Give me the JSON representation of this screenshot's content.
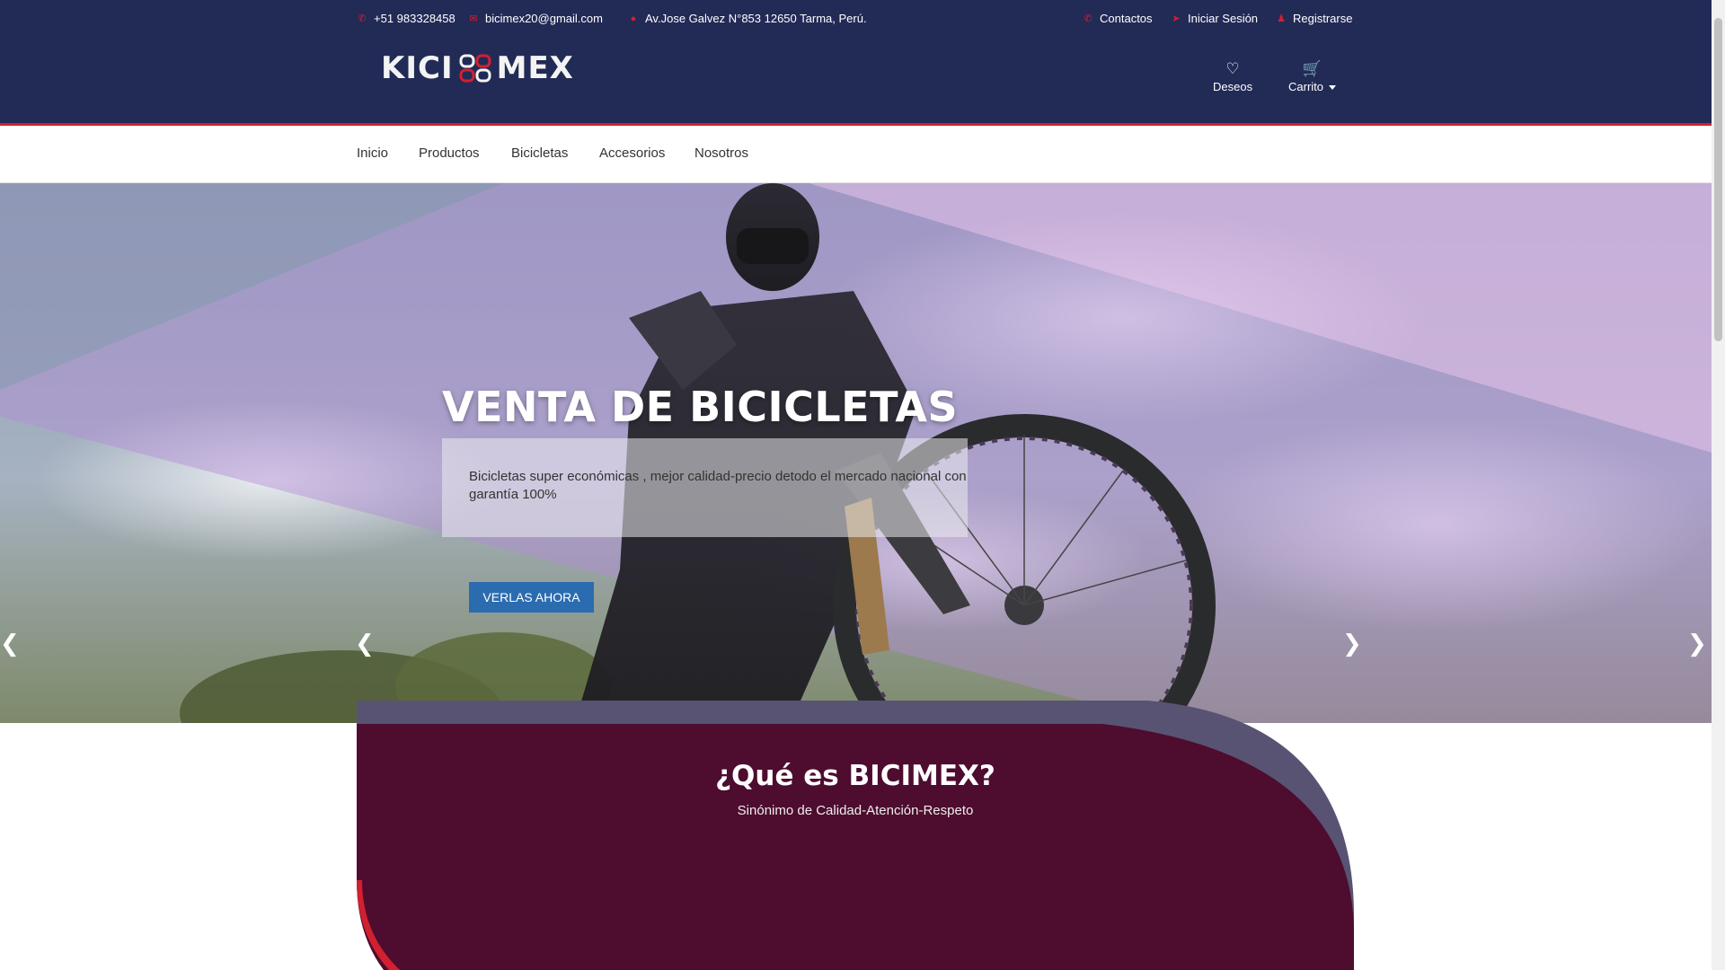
{
  "topbar": {
    "phone": "+51 983328458",
    "email": "bicimex20@gmail.com",
    "address": "Av.Jose Galvez N°853 12650 Tarma, Perú.",
    "contacts": "Contactos",
    "login": "Iniciar Sesión",
    "register": "Registrarse"
  },
  "header": {
    "logo_left": "KICI",
    "logo_right": "MEX",
    "wishlist": "Deseos",
    "cart": "Carrito"
  },
  "nav": [
    "Inicio",
    "Productos",
    "Bicicletas",
    "Accesorios",
    "Nosotros"
  ],
  "hero": {
    "title": "VENTA DE BICICLETAS",
    "caption": "Bicicletas super económicas , mejor calidad-precio detodo el mercado nacional con garantía 100%",
    "button": "VERLAS AHORA"
  },
  "about": {
    "title": "¿Qué es BICIMEX?",
    "subtitle": "Sinónimo de Calidad-Atención-Respeto"
  },
  "colors": {
    "navy": "#222a56",
    "accent": "#d1202f",
    "maroon": "#4e0c2f",
    "button": "#2b6cb0"
  }
}
